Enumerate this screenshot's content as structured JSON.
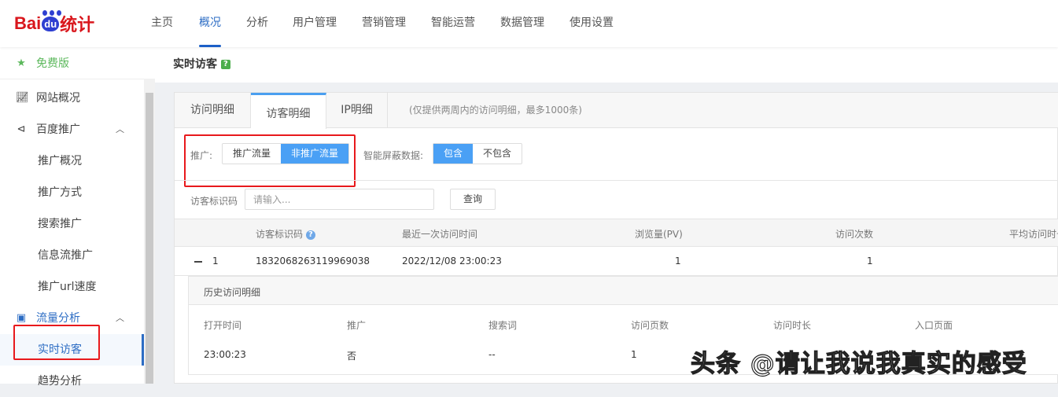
{
  "logo": {
    "text_left": "Bai",
    "text_du": "du",
    "text_right": "统计"
  },
  "nav": [
    {
      "label": "主页"
    },
    {
      "label": "概况"
    },
    {
      "label": "分析"
    },
    {
      "label": "用户管理"
    },
    {
      "label": "营销管理"
    },
    {
      "label": "智能运营"
    },
    {
      "label": "数据管理"
    },
    {
      "label": "使用设置"
    }
  ],
  "sidebar": {
    "plan": "免费版",
    "items": [
      {
        "label": "网站概况"
      },
      {
        "label": "百度推广"
      },
      {
        "label": "推广概况"
      },
      {
        "label": "推广方式"
      },
      {
        "label": "搜索推广"
      },
      {
        "label": "信息流推广"
      },
      {
        "label": "推广url速度"
      },
      {
        "label": "流量分析"
      },
      {
        "label": "实时访客"
      },
      {
        "label": "趋势分析"
      }
    ]
  },
  "page": {
    "title": "实时访客",
    "help": "?"
  },
  "tabs": [
    {
      "label": "访问明细"
    },
    {
      "label": "访客明细"
    },
    {
      "label": "IP明细"
    }
  ],
  "tab_note": "(仅提供两周内的访问明细，最多1000条)",
  "filters": {
    "promo_label": "推广:",
    "promo_options": [
      "推广流量",
      "非推广流量"
    ],
    "promo_selected": "非推广流量",
    "mask_label": "智能屏蔽数据:",
    "mask_options": [
      "包含",
      "不包含"
    ],
    "mask_selected": "包含"
  },
  "search": {
    "label": "访客标识码",
    "placeholder": "请输入...",
    "button": "查询"
  },
  "table": {
    "headers": [
      "访客标识码",
      "最近一次访问时间",
      "浏览量(PV)",
      "访问次数",
      "平均访问时长"
    ],
    "rows": [
      {
        "index": "1",
        "id": "1832068263119969038",
        "last_visit": "2022/12/08 23:00:23",
        "pv": "1",
        "visits": "1"
      }
    ]
  },
  "detail": {
    "title": "历史访问明细",
    "headers": [
      "打开时间",
      "推广",
      "搜索词",
      "访问页数",
      "访问时长",
      "入口页面"
    ],
    "rows": [
      {
        "open_time": "23:00:23",
        "promo": "否",
        "keyword": "--",
        "pages": "1"
      }
    ]
  },
  "watermark": "头条 @请让我说我真实的感受",
  "colors": {
    "accent": "#4aa0f5",
    "nav_active": "#1c5fc7",
    "highlight": "#e8191c",
    "free": "#5cb85c"
  }
}
